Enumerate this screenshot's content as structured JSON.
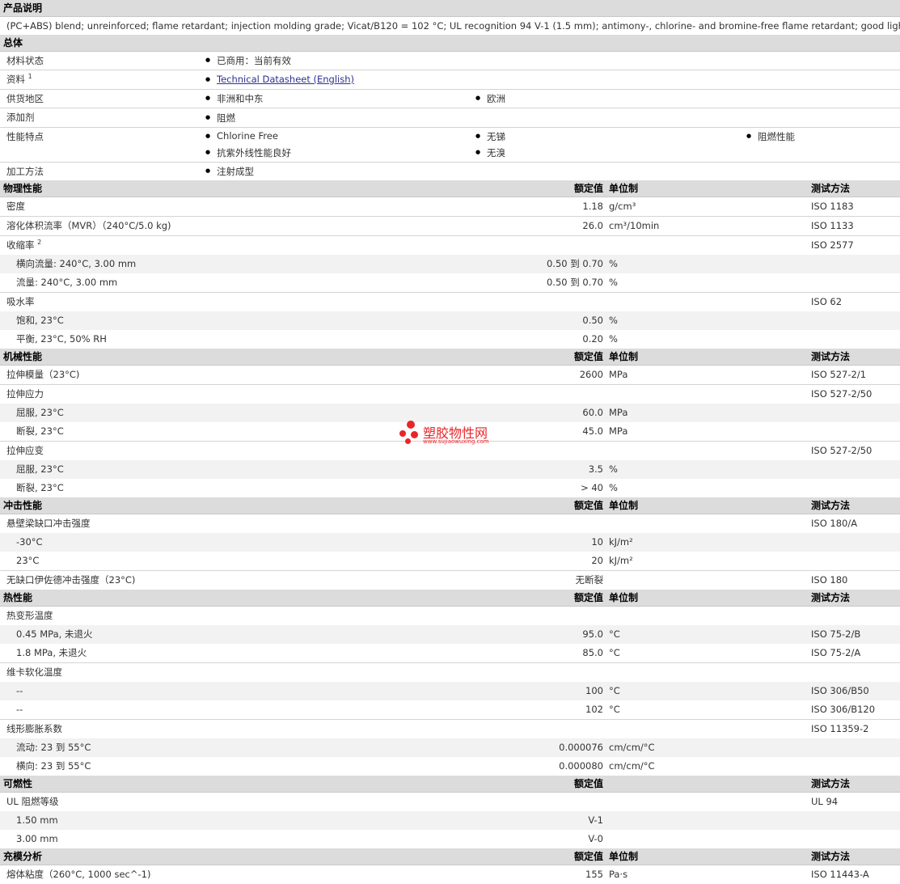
{
  "sections": {
    "desc": {
      "title": "产品说明",
      "text": "(PC+ABS) blend; unreinforced; flame retardant; injection molding grade; Vicat/B120 = 102 °C; UL recognition 94 V-1 (1.5 mm); antimony-, chlorine- and bromine-free flame retardant; good light stability."
    },
    "general": {
      "title": "总体",
      "rows": [
        {
          "label": "材料状态",
          "items": [
            "已商用：当前有效"
          ]
        },
        {
          "label": "资料",
          "sup": "1",
          "items": [
            "Technical Datasheet (English)"
          ]
        },
        {
          "label": "供货地区",
          "items": [
            "非洲和中东",
            "欧洲"
          ]
        },
        {
          "label": "添加剂",
          "items": [
            "阻燃"
          ]
        },
        {
          "label": "性能特点",
          "items": [
            "Chlorine Free",
            "无锑",
            "阻燃性能",
            "抗紫外线性能良好",
            "无溴"
          ]
        },
        {
          "label": "加工方法",
          "items": [
            "注射成型"
          ]
        }
      ]
    },
    "physical": {
      "title": "物理性能",
      "h_val": "额定值",
      "h_unit": "单位制",
      "h_test": "测试方法",
      "rows": [
        {
          "name": "密度",
          "value": "1.18",
          "unit": "g/cm³",
          "method": "ISO 1183"
        },
        {
          "name": "溶化体积流率（MVR）（240°C/5.0 kg)",
          "value": "26.0",
          "unit": "cm³/10min",
          "method": "ISO 1133"
        },
        {
          "name": "收缩率",
          "sup": "2",
          "value": "",
          "unit": "",
          "method": "ISO 2577"
        },
        {
          "name": "横向流量: 240°C, 3.00 mm",
          "value": "0.50 到  0.70",
          "unit": "%",
          "method": ""
        },
        {
          "name": "流量: 240°C, 3.00 mm",
          "value": "0.50 到  0.70",
          "unit": "%",
          "method": ""
        },
        {
          "name": "吸水率",
          "value": "",
          "unit": "",
          "method": "ISO 62"
        },
        {
          "name": "饱和, 23°C",
          "value": "0.50",
          "unit": "%",
          "method": ""
        },
        {
          "name": "平衡, 23°C, 50% RH",
          "value": "0.20",
          "unit": "%",
          "method": ""
        }
      ]
    },
    "mechanical": {
      "title": "机械性能",
      "h_val": "额定值",
      "h_unit": "单位制",
      "h_test": "测试方法",
      "rows": [
        {
          "name": "拉伸模量（23°C)",
          "value": "2600",
          "unit": "MPa",
          "method": "ISO 527-2/1"
        },
        {
          "name": "拉伸应力",
          "value": "",
          "unit": "",
          "method": "ISO 527-2/50"
        },
        {
          "name": "屈服, 23°C",
          "value": "60.0",
          "unit": "MPa",
          "method": ""
        },
        {
          "name": "断裂, 23°C",
          "value": "45.0",
          "unit": "MPa",
          "method": ""
        },
        {
          "name": "拉伸应变",
          "value": "",
          "unit": "",
          "method": "ISO 527-2/50"
        },
        {
          "name": "屈服, 23°C",
          "value": "3.5",
          "unit": "%",
          "method": ""
        },
        {
          "name": "断裂, 23°C",
          "value": "> 40",
          "unit": "%",
          "method": ""
        }
      ]
    },
    "impact": {
      "title": "冲击性能",
      "h_val": "额定值",
      "h_unit": "单位制",
      "h_test": "测试方法",
      "rows": [
        {
          "name": "悬壁梁缺口冲击强度",
          "value": "",
          "unit": "",
          "method": "ISO 180/A"
        },
        {
          "name": "-30°C",
          "value": "10",
          "unit": "kJ/m²",
          "method": ""
        },
        {
          "name": "23°C",
          "value": "20",
          "unit": "kJ/m²",
          "method": ""
        },
        {
          "name": "无缺口伊佐德冲击强度（23°C)",
          "value": "无断裂",
          "unit": "",
          "method": "ISO 180"
        }
      ]
    },
    "thermal": {
      "title": "热性能",
      "h_val": "额定值",
      "h_unit": "单位制",
      "h_test": "测试方法",
      "rows": [
        {
          "name": "热变形温度",
          "value": "",
          "unit": "",
          "method": ""
        },
        {
          "name": "0.45 MPa, 未退火",
          "value": "95.0",
          "unit": "°C",
          "method": "ISO 75-2/B"
        },
        {
          "name": "1.8 MPa, 未退火",
          "value": "85.0",
          "unit": "°C",
          "method": "ISO 75-2/A"
        },
        {
          "name": "维卡软化温度",
          "value": "",
          "unit": "",
          "method": ""
        },
        {
          "name": "--",
          "value": "100",
          "unit": "°C",
          "method": "ISO 306/B50"
        },
        {
          "name": "--",
          "value": "102",
          "unit": "°C",
          "method": "ISO 306/B120"
        },
        {
          "name": "线形膨胀系数",
          "value": "",
          "unit": "",
          "method": "ISO 11359-2"
        },
        {
          "name": "流动: 23 到  55°C",
          "value": "0.000076",
          "unit": "cm/cm/°C",
          "method": ""
        },
        {
          "name": "横向: 23 到  55°C",
          "value": "0.000080",
          "unit": "cm/cm/°C",
          "method": ""
        }
      ]
    },
    "flammability": {
      "title": "可燃性",
      "h_val": "额定值",
      "h_unit": "",
      "h_test": "测试方法",
      "rows": [
        {
          "name": "UL 阻燃等级",
          "value": "",
          "unit": "",
          "method": "UL 94"
        },
        {
          "name": "1.50 mm",
          "value": "V-1",
          "unit": "",
          "method": ""
        },
        {
          "name": "3.00 mm",
          "value": "V-0",
          "unit": "",
          "method": ""
        }
      ]
    },
    "filling": {
      "title": "充模分析",
      "h_val": "额定值",
      "h_unit": "单位制",
      "h_test": "测试方法",
      "rows": [
        {
          "name": "熔体粘度（260°C, 1000 sec^-1)",
          "value": "155",
          "unit": "Pa·s",
          "method": "ISO 11443-A"
        }
      ]
    }
  },
  "watermark": {
    "name": "塑胶物性网",
    "url": "www.sujiaowuxing.com",
    "color": "#e8262a"
  }
}
